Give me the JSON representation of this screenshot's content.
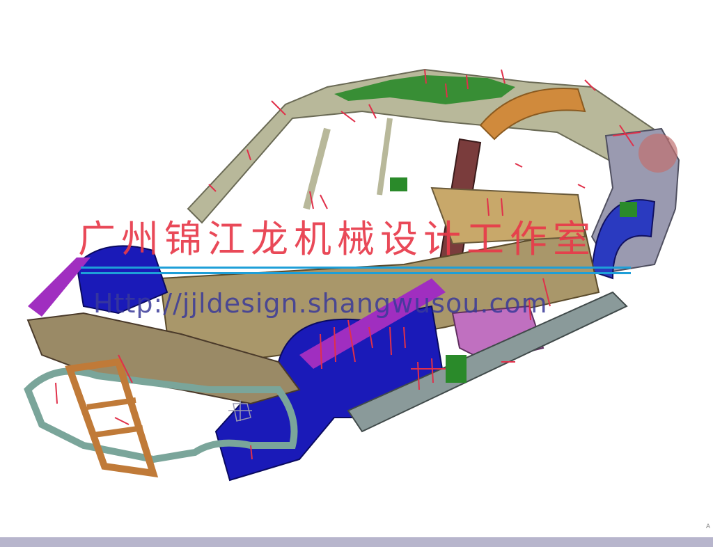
{
  "watermark": {
    "title": "广州锦江龙机械设计工作室",
    "url": "Http://jjldesign.shangwusou.com"
  },
  "corner_mark": "A",
  "colors": {
    "background": "#ffffff",
    "roof_frame": "#b8b89a",
    "floor_pan": "#a9976a",
    "wheel_arch": "#1a1ab8",
    "front_rail": "#9a8a66",
    "bumper_bracket": "#c07a38",
    "roof_bow": "#d08a3c",
    "b_pillar": "#7a3c3c",
    "sill": "#8a9a9a",
    "purple_trim": "#a02ec0",
    "green_parts": "#2a8a2a",
    "weld_marks": "#e0304a",
    "bottom_bar": "#b7b5cc"
  },
  "icons": {
    "axis_triad": "axis-triad-icon"
  }
}
